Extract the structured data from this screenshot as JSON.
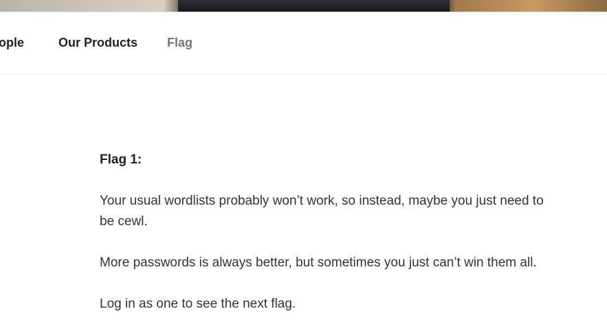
{
  "nav": {
    "items": [
      {
        "label": "People",
        "visible_text": "eople"
      },
      {
        "label": "Our Products"
      },
      {
        "label": "Flag",
        "current": true
      }
    ]
  },
  "content": {
    "heading": "Flag 1:",
    "paragraphs": [
      "Your usual wordlists probably won’t work, so instead, maybe you just need to be cewl.",
      "More passwords is always better, but sometimes you just can’t win them all.",
      "Log in as one to see the next flag."
    ]
  },
  "colors": {
    "text": "#333333",
    "heading": "#222222",
    "nav_current": "#767676",
    "divider": "#eeeeee"
  }
}
